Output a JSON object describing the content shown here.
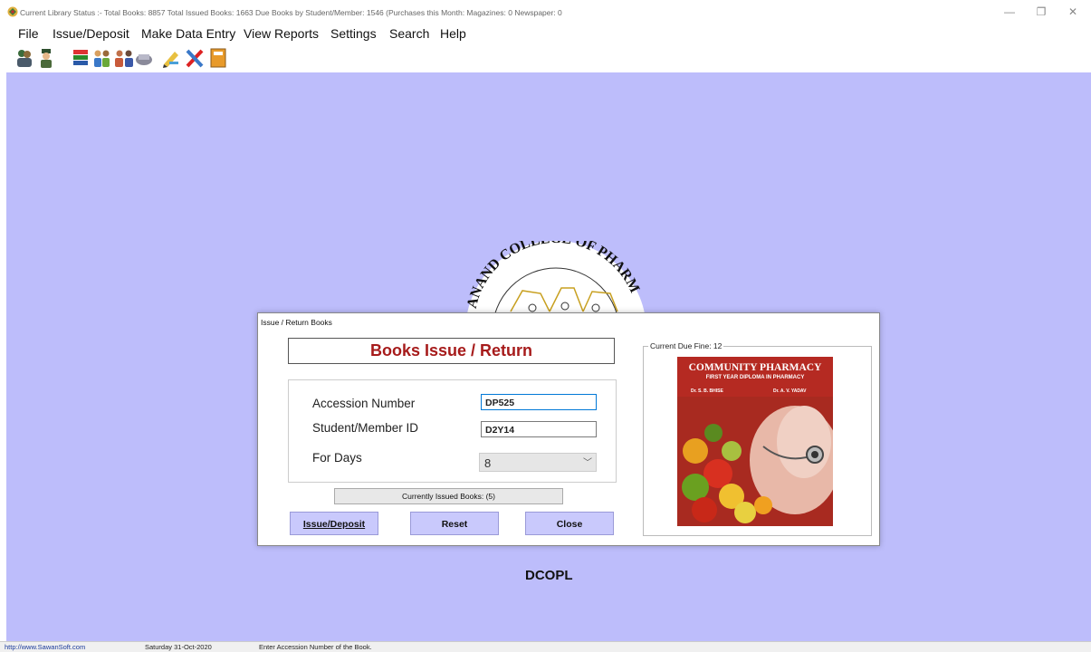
{
  "window": {
    "title": "Current Library Status :-  Total Books: 8857  Total Issued Books: 1663  Due Books by Student/Member:  1546  (Purchases this Month: Magazines: 0  Newspaper: 0",
    "minimize": "—",
    "restore": "❐",
    "close": "✕"
  },
  "menu": [
    "File",
    "Issue/Deposit",
    "Make Data Entry",
    "View Reports",
    "Settings",
    "Search",
    "Help"
  ],
  "toolbar": {
    "icons": [
      "student-icon",
      "member-icon",
      "books-icon",
      "group-icon",
      "users-icon",
      "magazine-icon",
      "pencil-icon",
      "tools-icon",
      "exit-icon"
    ]
  },
  "logo": {
    "arc_text": "ANAND COLLEGE OF PHARM"
  },
  "dialog": {
    "title": "Issue / Return Books",
    "heading": "Books Issue / Return",
    "fields": {
      "accession_label": "Accession Number",
      "accession_value": "DP525",
      "member_label": "Student/Member ID",
      "member_value": "D2Y14",
      "days_label": "For Days",
      "days_value": "8"
    },
    "issued_books": "Currently Issued Books: (5)",
    "buttons": {
      "issue": "Issue/Deposit",
      "reset": "Reset",
      "close": "Close"
    },
    "fine_label": "Current Due Fine: 12",
    "cover": {
      "title": "COMMUNITY PHARMACY",
      "subtitle": "FIRST YEAR DIPLOMA IN PHARMACY",
      "author1": "Dr. S. B. BHISE",
      "author2": "Dr. A. V. YADAV"
    }
  },
  "watermark": "DCOPL",
  "status": {
    "url": "http://www.SawanSoft.com",
    "date": "Saturday 31-Oct-2020",
    "message": "Enter Accession Number of the Book."
  },
  "colors": {
    "mdi_background": "#bdbdfb",
    "heading_red": "#a61b1b",
    "button_fill": "#c9c9fc"
  }
}
